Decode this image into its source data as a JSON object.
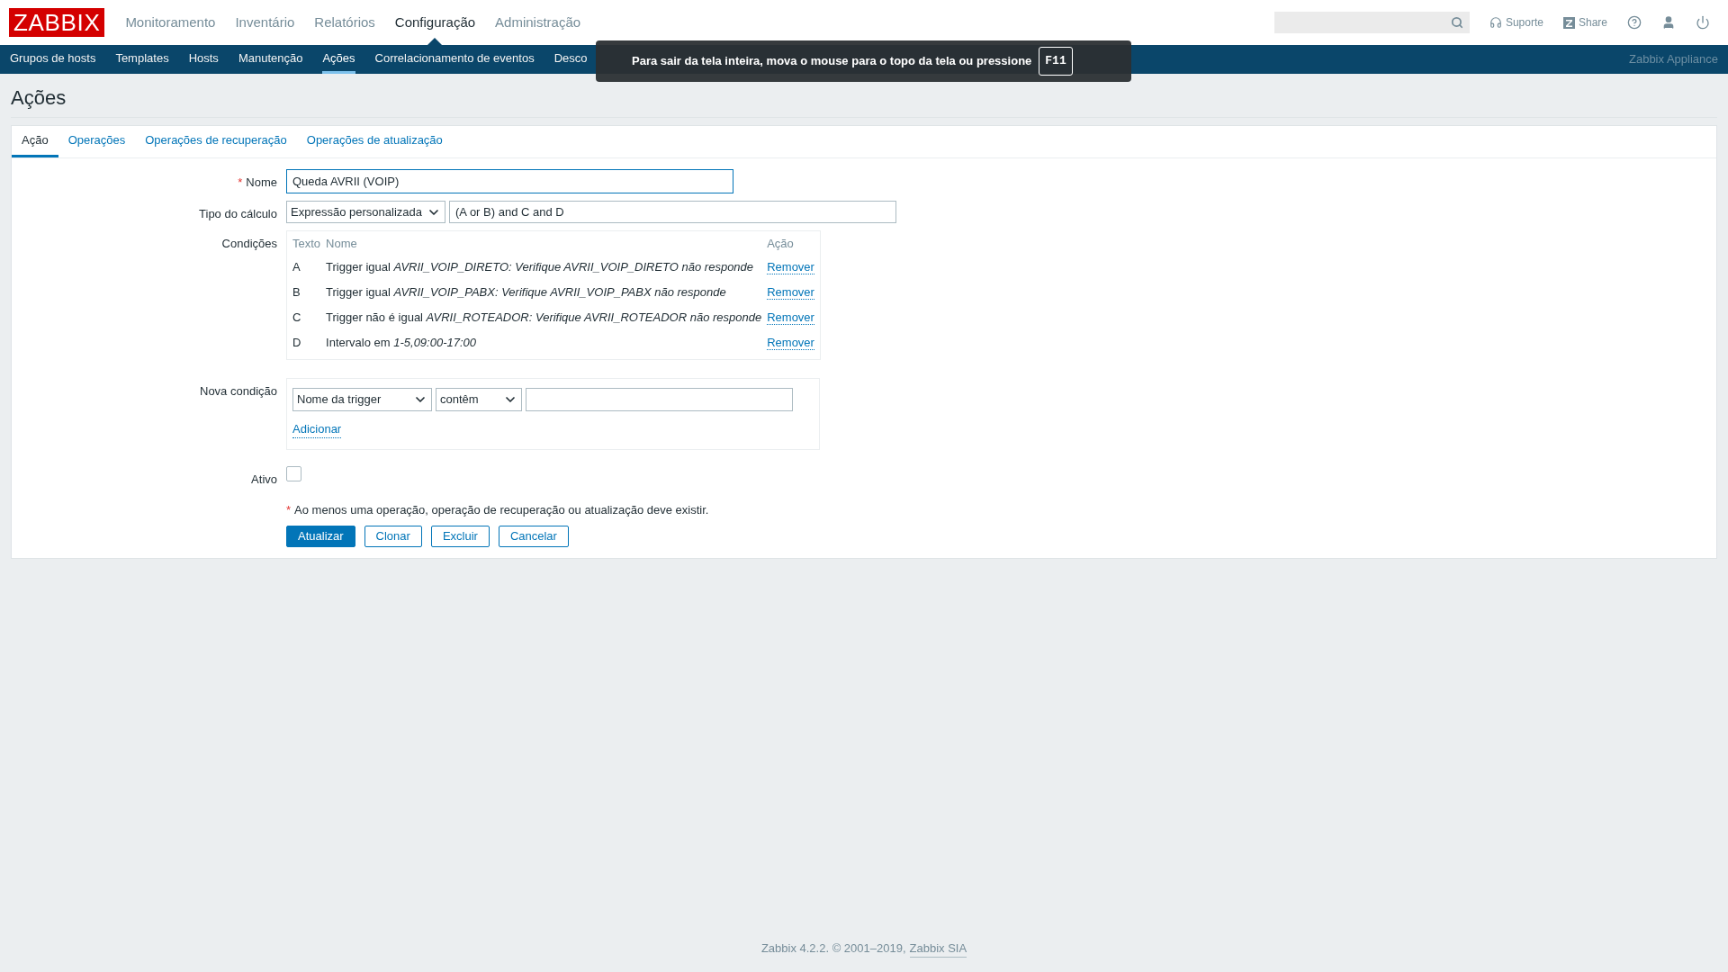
{
  "header": {
    "logo": "ZABBIX",
    "menu": [
      {
        "label": "Monitoramento",
        "selected": false
      },
      {
        "label": "Inventário",
        "selected": false
      },
      {
        "label": "Relatórios",
        "selected": false
      },
      {
        "label": "Configuração",
        "selected": true
      },
      {
        "label": "Administração",
        "selected": false
      }
    ],
    "links": [
      {
        "kind": "support",
        "label": "Suporte"
      },
      {
        "kind": "share",
        "label": "Share"
      },
      {
        "kind": "help"
      },
      {
        "kind": "user"
      },
      {
        "kind": "logout"
      }
    ]
  },
  "subnav": {
    "items": [
      {
        "label": "Grupos de hosts",
        "selected": false
      },
      {
        "label": "Templates",
        "selected": false
      },
      {
        "label": "Hosts",
        "selected": false
      },
      {
        "label": "Manutenção",
        "selected": false
      },
      {
        "label": "Ações",
        "selected": true
      },
      {
        "label": "Correlacionamento de eventos",
        "selected": false
      },
      {
        "label": "Desco",
        "selected": false
      }
    ],
    "server": "Zabbix Appliance"
  },
  "fullscreen_notice": {
    "text": "Para sair da tela inteira, mova o mouse para o topo da tela ou pressione",
    "key": "F11"
  },
  "page_title": "Ações",
  "tabs": [
    {
      "label": "Ação",
      "selected": true
    },
    {
      "label": "Operações",
      "selected": false
    },
    {
      "label": "Operações de recuperação",
      "selected": false
    },
    {
      "label": "Operações de atualização",
      "selected": false
    }
  ],
  "form": {
    "name": {
      "label": "Nome",
      "required_mark": "*",
      "value": "Queda AVRII (VOIP)"
    },
    "calc": {
      "label": "Tipo do cálculo",
      "select": "Expressão personalizada",
      "formula": "(A or B) and C and D"
    },
    "conditions": {
      "label": "Condições",
      "columns": [
        "Texto",
        "Nome",
        "Ação"
      ],
      "rows": [
        {
          "tag": "A",
          "name": "Trigger igual *AVRII_VOIP_DIRETO: Verifique AVRII_VOIP_DIRETO não responde*",
          "action": "Remover"
        },
        {
          "tag": "B",
          "name": "Trigger igual *AVRII_VOIP_PABX: Verifique AVRII_VOIP_PABX não responde*",
          "action": "Remover"
        },
        {
          "tag": "C",
          "name": "Trigger não é igual *AVRII_ROTEADOR: Verifique AVRII_ROTEADOR não responde*",
          "action": "Remover"
        },
        {
          "tag": "D",
          "name": "Intervalo em *1-5,09:00-17:00*",
          "action": "Remover"
        }
      ]
    },
    "new_condition": {
      "label": "Nova condição",
      "type": "Nome da trigger",
      "operator": "contêm",
      "add": "Adicionar"
    },
    "active": {
      "label": "Ativo",
      "checked": false
    },
    "note": {
      "mark": "*",
      "text": "Ao menos uma operação, operação de recuperação ou atualização deve existir."
    },
    "buttons": [
      {
        "label": "Atualizar",
        "kind": "primary"
      },
      {
        "label": "Clonar",
        "kind": "secondary"
      },
      {
        "label": "Excluir",
        "kind": "secondary"
      },
      {
        "label": "Cancelar",
        "kind": "secondary"
      }
    ]
  },
  "footer": {
    "text": "Zabbix 4.2.2. © 2001–2019,",
    "link": "Zabbix SIA"
  }
}
